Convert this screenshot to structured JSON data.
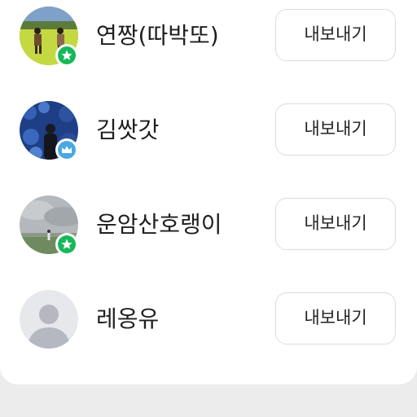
{
  "members": [
    {
      "name": "연짱(따박또)",
      "badge": "star-badge",
      "button_label": "내보내기"
    },
    {
      "name": "김쌋갓",
      "badge": "crown-badge",
      "button_label": "내보내기"
    },
    {
      "name": "운암산호랭이",
      "badge": "star-badge",
      "button_label": "내보내기"
    },
    {
      "name": "레옹유",
      "badge": "none",
      "button_label": "내보내기"
    }
  ],
  "colors": {
    "star_badge": "#16b85a",
    "crown_badge": "#4aa8e0",
    "default_avatar_bg": "#e7e8ec",
    "default_avatar_fg": "#b5b8c0",
    "card_bg": "#ffffff",
    "page_bg": "#ececec"
  }
}
